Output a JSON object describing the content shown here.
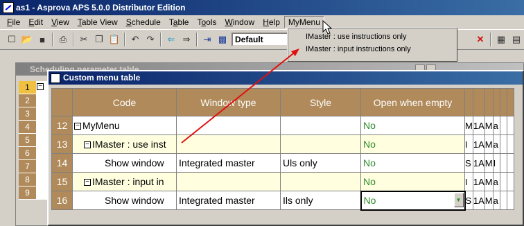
{
  "window": {
    "title": "as1 - Asprova APS 5.0.0 Distributor Edition"
  },
  "menubar": {
    "items": [
      {
        "label": "File",
        "mnemonic": "F",
        "rest": "ile"
      },
      {
        "label": "Edit",
        "mnemonic": "E",
        "rest": "dit"
      },
      {
        "label": "View",
        "mnemonic": "V",
        "rest": "iew"
      },
      {
        "label": "Table View",
        "mnemonic": "T",
        "rest": "able View"
      },
      {
        "label": "Schedule",
        "mnemonic": "S",
        "rest": "chedule"
      },
      {
        "label": "Table",
        "pre": "T",
        "mnemonic": "a",
        "rest": "ble"
      },
      {
        "label": "Tools",
        "pre": "T",
        "mnemonic": "o",
        "rest": "ols"
      },
      {
        "label": "Window",
        "mnemonic": "W",
        "rest": "indow"
      },
      {
        "label": "Help",
        "mnemonic": "H",
        "rest": "elp"
      },
      {
        "label": "MyMenu"
      }
    ]
  },
  "toolbar": {
    "combo_value": "Default"
  },
  "mymenu_dropdown": {
    "items": [
      "IMaster : use instructions only",
      "IMaster : input instructions only"
    ]
  },
  "background_window": {
    "title": "Scheduling parameter table",
    "row_numbers": [
      "1",
      "2",
      "3",
      "4",
      "5",
      "6",
      "7",
      "8",
      "9"
    ]
  },
  "custom_menu_window": {
    "title": "Custom menu table",
    "columns": [
      "Code",
      "Window type",
      "Style",
      "Open when empty"
    ],
    "rows": [
      {
        "num": "12",
        "code": "MyMenu",
        "tree": "root",
        "window_type": "",
        "style": "",
        "open": "No",
        "extra": [
          "M",
          "1A",
          "M",
          "a"
        ],
        "yellow": false
      },
      {
        "num": "13",
        "code": "IMaster : use inst",
        "tree": "child",
        "window_type": "",
        "style": "",
        "open": "No",
        "extra": [
          "I",
          "1A",
          "M",
          "a"
        ],
        "yellow": true
      },
      {
        "num": "14",
        "code": "Show window",
        "tree": "leaf",
        "window_type": "Integrated master",
        "style": "Uls only",
        "open": "No",
        "extra": [
          "S",
          "1A",
          "M",
          "I"
        ],
        "yellow": false
      },
      {
        "num": "15",
        "code": "IMaster : input in",
        "tree": "child",
        "window_type": "",
        "style": "",
        "open": "No",
        "extra": [
          "I",
          "1A",
          "M",
          "a"
        ],
        "yellow": true
      },
      {
        "num": "16",
        "code": "Show window",
        "tree": "leaf",
        "window_type": "Integrated master",
        "style": "Ils only",
        "open": "No",
        "extra": [
          "S",
          "1A",
          "M",
          "a"
        ],
        "yellow": false
      }
    ]
  },
  "colors": {
    "header_bg": "#b08a5a",
    "yellow_row": "#ffffe0",
    "open_text": "#2a8a2a",
    "arrow": "#e01010"
  }
}
